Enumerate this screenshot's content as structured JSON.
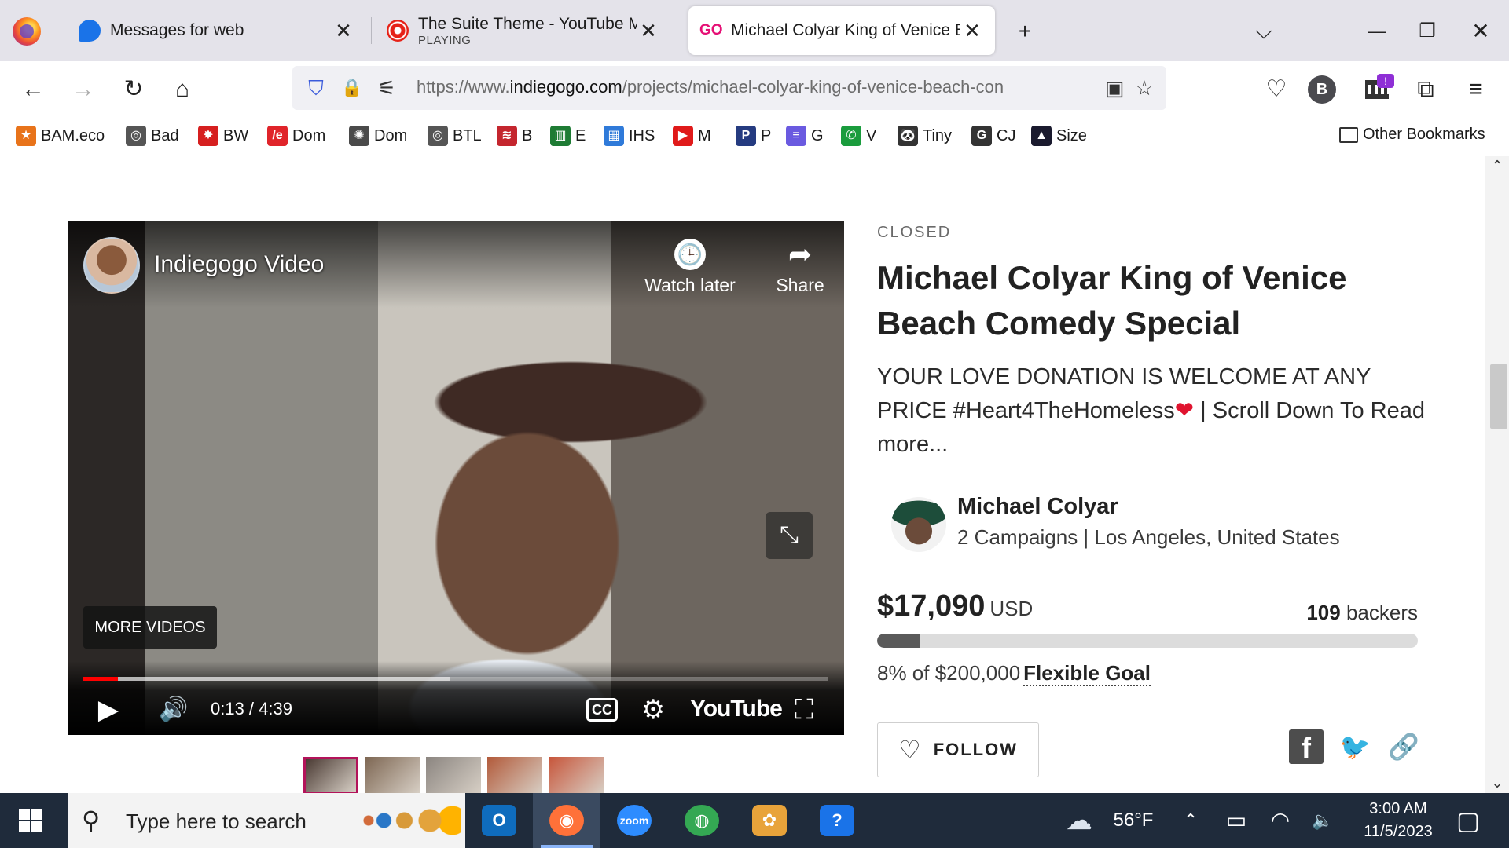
{
  "tabs": [
    {
      "title": "Messages for web",
      "subtitle": "",
      "favicon": "messages-icon",
      "active": false
    },
    {
      "title": "The Suite Theme - YouTube Mu",
      "subtitle": "PLAYING",
      "favicon": "youtube-music-icon",
      "active": false
    },
    {
      "title": "Michael Colyar King of Venice B",
      "subtitle": "",
      "favicon": "indiegogo-icon",
      "favicon_text": "GO",
      "active": true
    }
  ],
  "toolbar_glyphs": {
    "close": "✕",
    "new_tab": "+",
    "tab_list": "⌵",
    "minimize": "—",
    "restore": "❐",
    "window_close": "✕"
  },
  "nav": {
    "url_prefix": "https://www.",
    "url_domain": "indiegogo.com",
    "url_path": "/projects/michael-colyar-king-of-venice-beach-con",
    "glyphs": {
      "back": "←",
      "forward": "→",
      "reload": "↻",
      "home": "⌂",
      "shield": "⛉",
      "lock": "🔒",
      "tune": "⚟",
      "reader": "▣",
      "star": "☆",
      "pocket": "♡",
      "profile": "B",
      "extensions": "⧉",
      "menu": "≡"
    }
  },
  "bookmarks": [
    {
      "label": "BAM.eco",
      "color": "#e8731a",
      "icon_text": "★"
    },
    {
      "label": "Bad",
      "color": "#555555",
      "icon_text": "◎"
    },
    {
      "label": "BW",
      "color": "#d61f1f",
      "icon_text": "✸"
    },
    {
      "label": "Dom",
      "color": "#e0242a",
      "icon_text": "/e"
    },
    {
      "label": "Dom",
      "color": "#4a4a4a",
      "icon_text": "✺"
    },
    {
      "label": "BTL",
      "color": "#555555",
      "icon_text": "◎"
    },
    {
      "label": "B",
      "color": "#c4262e",
      "icon_text": "≋"
    },
    {
      "label": "E",
      "color": "#1e7b34",
      "icon_text": "▥"
    },
    {
      "label": "IHS",
      "color": "#2f7ad9",
      "icon_text": "▦"
    },
    {
      "label": "M",
      "color": "#e01a1a",
      "icon_text": "▶"
    },
    {
      "label": "P",
      "color": "#253b80",
      "icon_text": "P"
    },
    {
      "label": "G",
      "color": "#6a5ae0",
      "icon_text": "≡"
    },
    {
      "label": "V",
      "color": "#1a9c3d",
      "icon_text": "✆"
    },
    {
      "label": "Tiny",
      "color": "#333333",
      "icon_text": "🐼"
    },
    {
      "label": "CJ",
      "color": "#333333",
      "icon_text": "G"
    },
    {
      "label": "Size",
      "color": "#1a1a2e",
      "icon_text": "▲"
    }
  ],
  "other_bookmarks": "Other Bookmarks",
  "video": {
    "channel_title": "Indiegogo Video",
    "watch_later": "Watch later",
    "share": "Share",
    "more_videos": "MORE VIDEOS",
    "time": "0:13 / 4:39",
    "youtube_label": "YouTube",
    "cc": "CC",
    "played_fraction": 0.0466,
    "buffered_fraction": 0.4926,
    "glyphs": {
      "clock": "🕒",
      "share": "➦",
      "minimize": "⤡",
      "play": "▶",
      "volume": "🔊",
      "settings": "⚙",
      "fullscreen": "⛶"
    }
  },
  "thumbnails": [
    {
      "color": "#4a3a33",
      "selected": true
    },
    {
      "color": "#7d6652",
      "selected": false
    },
    {
      "color": "#8b8580",
      "selected": false
    },
    {
      "color": "#b25a3a",
      "selected": false
    },
    {
      "color": "#c7553a",
      "selected": false
    }
  ],
  "campaign": {
    "status": "CLOSED",
    "title": "Michael Colyar King of Venice Beach Comedy Special",
    "tagline_part1": "YOUR LOVE DONATION IS WELCOME AT ANY PRICE #Heart4TheHomeless",
    "tagline_heart": "❤",
    "tagline_part2": " | Scroll Down To Read more...",
    "owner_name": "Michael Colyar",
    "owner_meta": "2 Campaigns | Los Angeles, United States",
    "raised": "$17,090",
    "currency": "USD",
    "backers_count": "109",
    "backers_label": "backers",
    "funded_fraction": 0.08,
    "goal_text": "8% of $200,000",
    "goal_type": "Flexible Goal",
    "follow_heart": "♡",
    "follow_label": "FOLLOW",
    "social_glyphs": {
      "facebook": "f",
      "twitter": "🐦",
      "link": "🔗"
    }
  },
  "scroll_glyphs": {
    "up": "⌃",
    "down": "⌄"
  },
  "taskbar": {
    "search_placeholder": "Type here to search",
    "search_glyph": "⚲",
    "apps": [
      {
        "name": "outlook",
        "label": "O",
        "color": "#0f6cbd",
        "active": false
      },
      {
        "name": "firefox",
        "label": "◉",
        "color": "#ff7139",
        "active": true
      },
      {
        "name": "zoom",
        "label": "zoom",
        "color": "#2d8cff",
        "active": false
      },
      {
        "name": "chrome",
        "label": "◍",
        "color": "#34a853",
        "active": false
      },
      {
        "name": "app",
        "label": "✿",
        "color": "#e8a33a",
        "active": false
      },
      {
        "name": "help",
        "label": "?",
        "color": "#1a73e8",
        "active": false
      }
    ],
    "temperature": "56°F",
    "time": "3:00 AM",
    "date": "11/5/2023",
    "tray_glyphs": {
      "weather": "☁",
      "chevron": "⌃",
      "battery": "▭",
      "wifi": "◠",
      "volume": "🔈",
      "notifications": "▢"
    }
  }
}
